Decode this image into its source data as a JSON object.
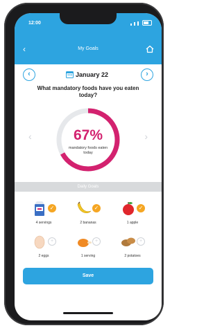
{
  "status_bar": {
    "time": "12:00"
  },
  "header": {
    "title": "My Goals",
    "back_icon": "chevron-left-icon",
    "home_icon": "home-icon"
  },
  "date_nav": {
    "date": "January 22",
    "prev_icon": "chevron-left-circle-icon",
    "next_icon": "chevron-right-circle-icon"
  },
  "question": "What mandatory foods have you eaten today?",
  "progress": {
    "percent_label": "67%",
    "fraction": 0.67,
    "subtitle": "mandatory foods eaten today",
    "color": "#d3226f"
  },
  "daily_goals_title": "Daily Goals",
  "foods": [
    {
      "label": "4 servings",
      "icon": "milk-carton-icon",
      "checked": true
    },
    {
      "label": "2 bananas",
      "icon": "banana-icon",
      "checked": true
    },
    {
      "label": "1 apple",
      "icon": "apple-icon",
      "checked": true
    },
    {
      "label": "2 eggs",
      "icon": "egg-icon",
      "checked": false
    },
    {
      "label": "1 serving",
      "icon": "chicken-icon",
      "checked": false
    },
    {
      "label": "2 potatoes",
      "icon": "potato-icon",
      "checked": false
    }
  ],
  "save_label": "Save",
  "colors": {
    "accent": "#2da4e0",
    "check": "#f5a623",
    "ring": "#d3226f"
  }
}
